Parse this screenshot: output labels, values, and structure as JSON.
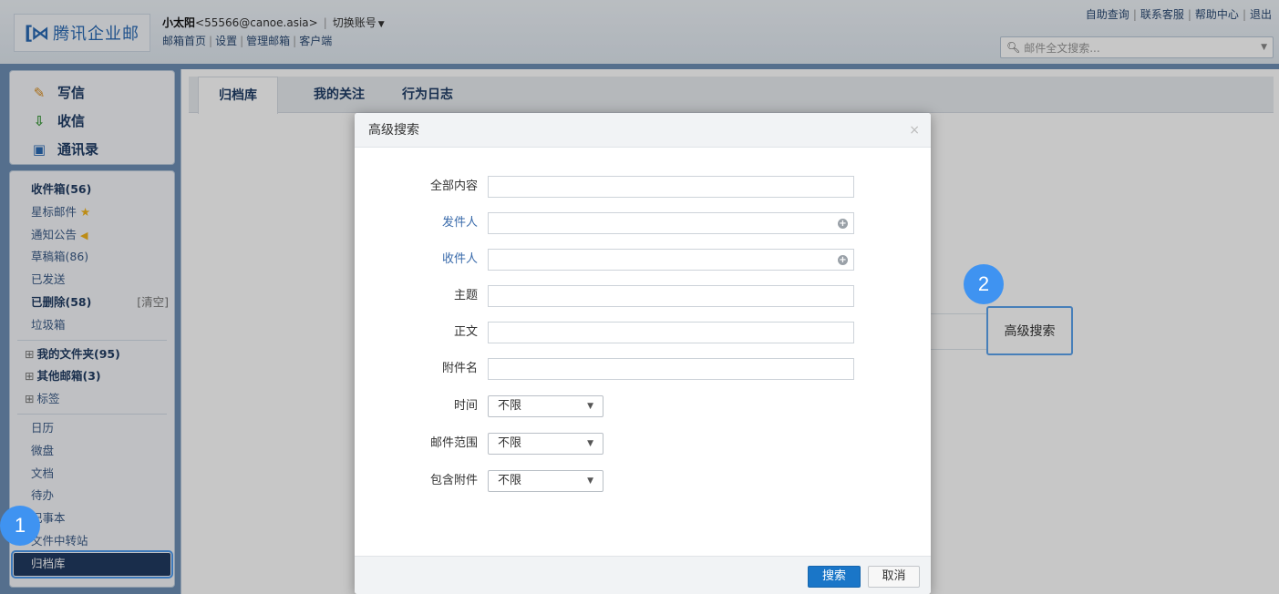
{
  "header": {
    "logo_mark": "[⋈",
    "logo_text": "腾讯企业邮",
    "user_name": "小太阳",
    "user_email": "<55566@canoe.asia>",
    "switch_account": "切换账号",
    "nav": [
      "邮箱首页",
      "设置",
      "管理邮箱",
      "客户端"
    ],
    "top_links": [
      "自助查询",
      "联系客服",
      "帮助中心",
      "退出"
    ],
    "search_placeholder": "邮件全文搜索..."
  },
  "sidebar": {
    "actions": [
      {
        "label": "写信",
        "icon": "compose-icon"
      },
      {
        "label": "收信",
        "icon": "receive-icon"
      },
      {
        "label": "通讯录",
        "icon": "contacts-icon"
      }
    ],
    "folders": {
      "inbox": "收件箱(56)",
      "starred": "星标邮件",
      "notice": "通知公告",
      "drafts": "草稿箱(86)",
      "sent": "已发送",
      "deleted": "已删除(58)",
      "deleted_clear": "[清空]",
      "spam": "垃圾箱",
      "my_folders": "我的文件夹(95)",
      "other_mailboxes": "其他邮箱(3)",
      "tags": "标签"
    },
    "apps": [
      "日历",
      "微盘",
      "文档",
      "待办",
      "记事本",
      "文件中转站",
      "归档库"
    ]
  },
  "main": {
    "tabs": [
      "归档库",
      "我的关注",
      "行为日志"
    ],
    "advanced_search_button": "高级搜索"
  },
  "modal": {
    "title": "高级搜索",
    "close": "×",
    "fields": {
      "all_content": "全部内容",
      "sender": "发件人",
      "recipient": "收件人",
      "subject": "主题",
      "body": "正文",
      "attachment_name": "附件名",
      "time": "时间",
      "mail_scope": "邮件范围",
      "has_attachment": "包含附件"
    },
    "select_default": "不限",
    "search_button": "搜索",
    "cancel_button": "取消"
  },
  "badges": [
    "1",
    "2"
  ],
  "colors": {
    "primary": "#1a76c8",
    "badge": "#3f93f1",
    "sidebar_active": "#213a60",
    "highlight_border": "#5ba3ee"
  }
}
